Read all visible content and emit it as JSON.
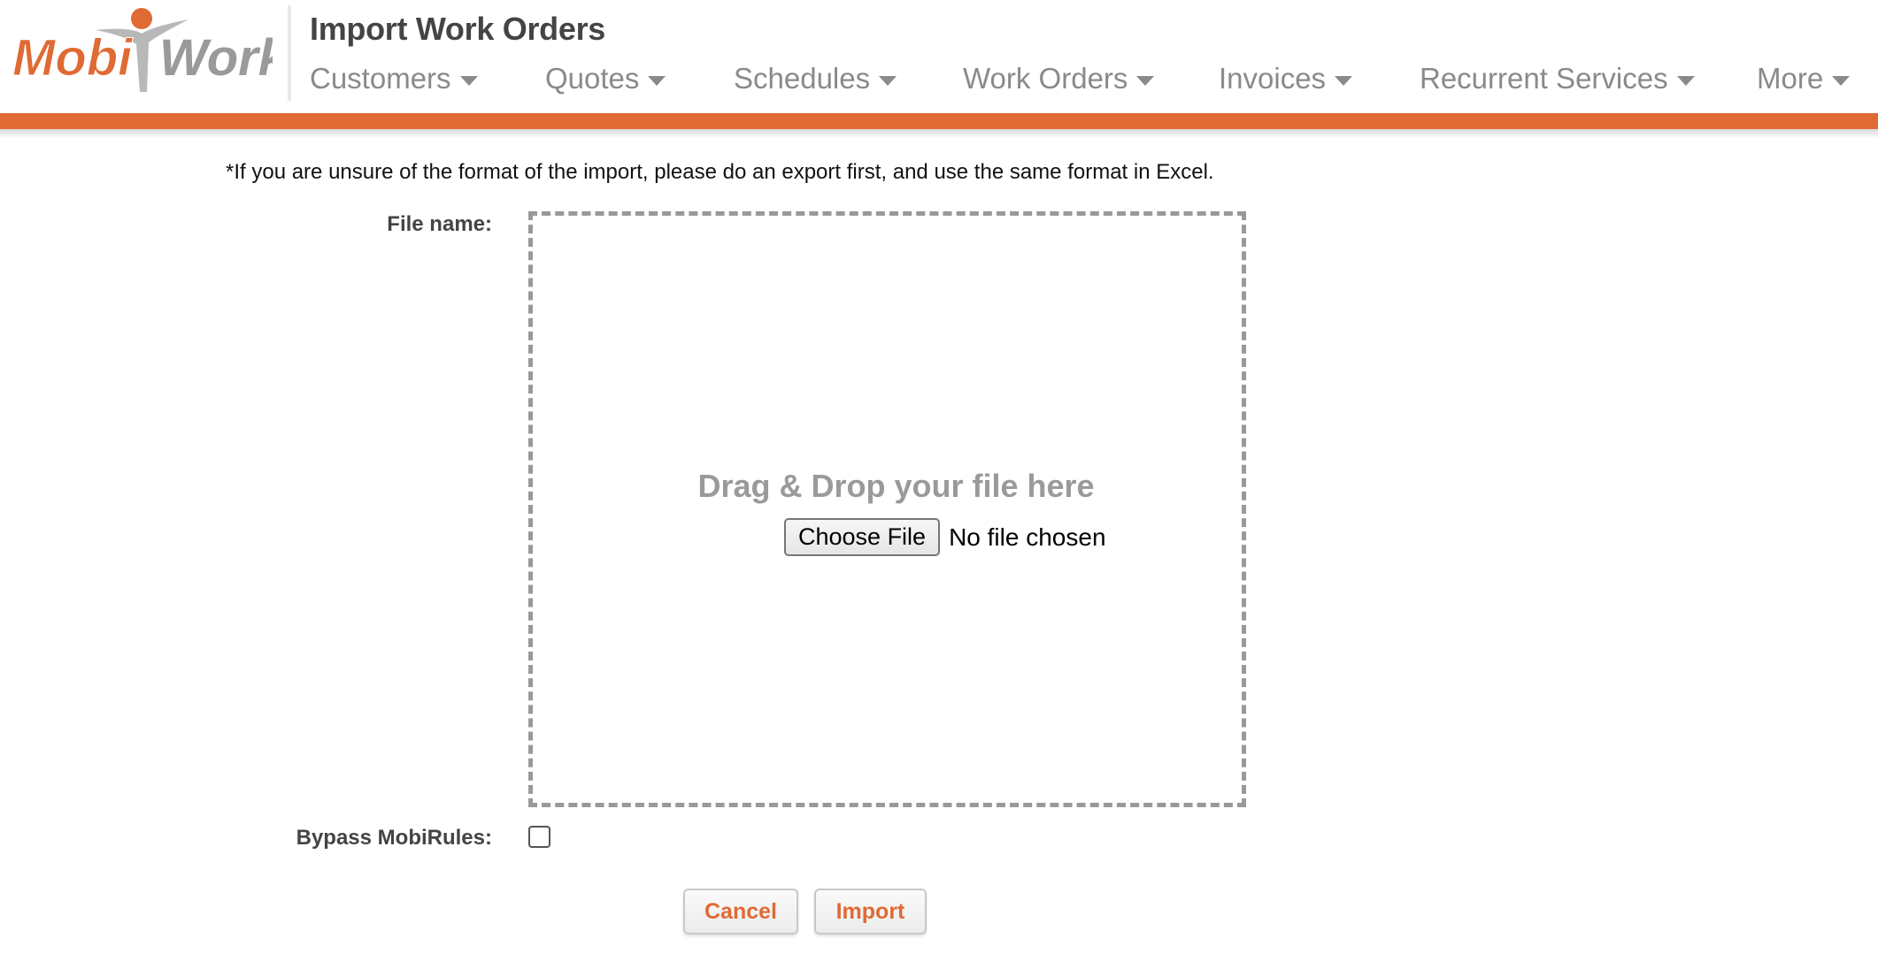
{
  "brand": {
    "logo_text": "MobiWork",
    "logo_word_1": "Mobi",
    "logo_word_2": "Work",
    "colors": {
      "accent": "#e06a34",
      "gray": "#8a8a8a",
      "logo_gray": "#9a9a9a"
    }
  },
  "header": {
    "title": "Import Work Orders"
  },
  "nav": {
    "items": [
      {
        "label": "Customers",
        "icon": "chevron-down-icon"
      },
      {
        "label": "Quotes",
        "icon": "chevron-down-icon"
      },
      {
        "label": "Schedules",
        "icon": "chevron-down-icon"
      },
      {
        "label": "Work Orders",
        "icon": "chevron-down-icon"
      },
      {
        "label": "Invoices",
        "icon": "chevron-down-icon"
      },
      {
        "label": "Recurrent Services",
        "icon": "chevron-down-icon"
      },
      {
        "label": "More",
        "icon": "chevron-down-icon"
      }
    ]
  },
  "form": {
    "note": "*If you are unsure of the format of the import, please do an export first, and use the same format in Excel.",
    "file_label": "File name:",
    "drop_text": "Drag & Drop your file here",
    "choose_file_label": "Choose File",
    "file_status": "No file chosen",
    "bypass_label": "Bypass MobiRules:",
    "bypass_checked": false
  },
  "actions": {
    "cancel_label": "Cancel",
    "import_label": "Import"
  }
}
